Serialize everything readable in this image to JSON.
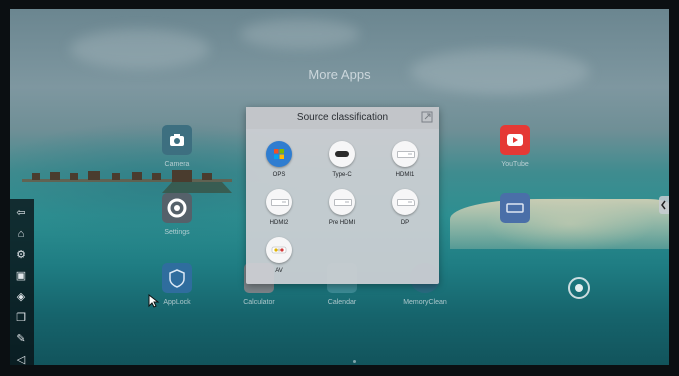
{
  "page": {
    "title": "More Apps"
  },
  "apps": [
    {
      "label": "Camera",
      "icon": "camera-icon",
      "color": "#3d6f80"
    },
    {
      "label": "Settings",
      "icon": "gear-icon",
      "color": "#55616a"
    },
    {
      "label": "AppLock",
      "icon": "shield-icon",
      "color": "#2f6d9e"
    },
    {
      "label": "Calculator",
      "icon": "calculator-icon",
      "color": "#7b8388"
    },
    {
      "label": "Calendar",
      "icon": "calendar-icon",
      "color": "#3c8a94"
    },
    {
      "label": "MemoryClean",
      "icon": "broom-icon",
      "color": "#2a6a80"
    },
    {
      "label": "YouTube",
      "icon": "youtube-icon",
      "color": "#e53935"
    },
    {
      "label": "",
      "icon": "screen-icon",
      "color": "#4a6fa8"
    }
  ],
  "dialog": {
    "title": "Source classification",
    "close_icon": "close-icon",
    "sources": [
      {
        "label": "OPS",
        "icon": "windows-icon"
      },
      {
        "label": "Type-C",
        "icon": "usb-c-icon"
      },
      {
        "label": "HDMI1",
        "icon": "hdmi-icon"
      },
      {
        "label": "HDMI2",
        "icon": "hdmi-icon"
      },
      {
        "label": "Pre HDMI",
        "icon": "hdmi-icon"
      },
      {
        "label": "DP",
        "icon": "displayport-icon"
      },
      {
        "label": "AV",
        "icon": "av-icon"
      }
    ]
  },
  "sidebar": {
    "items": [
      {
        "icon": "back-icon",
        "glyph": "⇦"
      },
      {
        "icon": "home-icon",
        "glyph": "⌂"
      },
      {
        "icon": "settings-icon",
        "glyph": "⚙"
      },
      {
        "icon": "source-icon",
        "glyph": "▣"
      },
      {
        "icon": "layers-icon",
        "glyph": "◈"
      },
      {
        "icon": "windows-icon",
        "glyph": "❐"
      },
      {
        "icon": "annotate-icon",
        "glyph": "✎"
      },
      {
        "icon": "volume-icon",
        "glyph": "◁"
      }
    ]
  },
  "colors": {
    "accent": "#2d8f91",
    "dialog_bg": "#cdd0d4"
  }
}
